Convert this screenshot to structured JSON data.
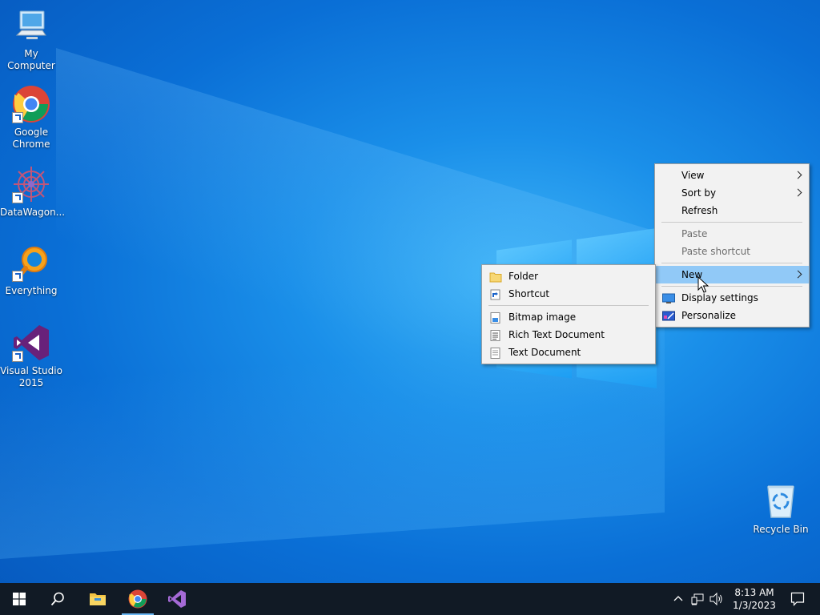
{
  "desktop": {
    "icons": [
      {
        "label": "My Computer",
        "icon": "computer-icon"
      },
      {
        "label": "Google Chrome",
        "icon": "chrome-icon"
      },
      {
        "label": "DataWagon...",
        "icon": "datawagon-icon"
      },
      {
        "label": "Everything",
        "icon": "everything-search-icon"
      },
      {
        "label": "Visual Studio 2015",
        "icon": "visual-studio-icon"
      },
      {
        "label": "Recycle Bin",
        "icon": "recycle-bin-icon"
      }
    ]
  },
  "context_menu": {
    "items": [
      {
        "label": "View",
        "submenu": true
      },
      {
        "label": "Sort by",
        "submenu": true
      },
      {
        "label": "Refresh"
      },
      {
        "label": "Paste",
        "disabled": true
      },
      {
        "label": "Paste shortcut",
        "disabled": true
      },
      {
        "label": "New",
        "submenu": true,
        "highlighted": true
      },
      {
        "label": "Display settings",
        "icon": "display-icon"
      },
      {
        "label": "Personalize",
        "icon": "personalize-icon"
      }
    ]
  },
  "new_submenu": {
    "items": [
      {
        "label": "Folder",
        "icon": "folder-icon"
      },
      {
        "label": "Shortcut",
        "icon": "shortcut-icon"
      },
      {
        "label": "Bitmap image",
        "icon": "bitmap-icon"
      },
      {
        "label": "Rich Text Document",
        "icon": "rtf-document-icon"
      },
      {
        "label": "Text Document",
        "icon": "text-document-icon"
      }
    ]
  },
  "taskbar": {
    "buttons": [
      "start-icon",
      "search-icon",
      "file-explorer-icon",
      "chrome-icon",
      "visual-studio-icon"
    ],
    "clock": {
      "time": "8:13 AM",
      "date": "1/3/2023"
    }
  },
  "colors": {
    "menu_bg": "#f2f2f2",
    "menu_highlight": "#91c9f7",
    "taskbar_bg": "#111a25",
    "accent": "#0a6fd6"
  }
}
